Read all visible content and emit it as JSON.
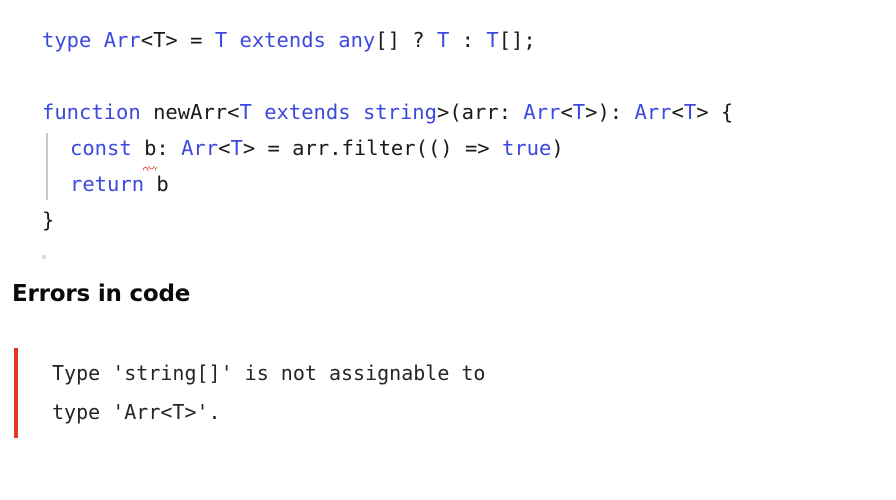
{
  "colors": {
    "keyword_blue": "#3b49df",
    "code_text": "#1a1a1a",
    "error_red": "#e8352a",
    "squiggle_red": "#e0392b",
    "indent_guide": "#c9c9c9",
    "heading": "#0a0a0a",
    "background": "#ffffff"
  },
  "code": {
    "language": "typescript",
    "lines": [
      {
        "id": "line-1",
        "indent": 0,
        "tokens": [
          {
            "text": "type",
            "kind": "keyword"
          },
          {
            "text": " ",
            "kind": "plain"
          },
          {
            "text": "Arr",
            "kind": "type"
          },
          {
            "text": "<T> = ",
            "kind": "plain"
          },
          {
            "text": "T",
            "kind": "type"
          },
          {
            "text": " ",
            "kind": "plain"
          },
          {
            "text": "extends",
            "kind": "keyword"
          },
          {
            "text": " ",
            "kind": "plain"
          },
          {
            "text": "any",
            "kind": "type"
          },
          {
            "text": "[] ? ",
            "kind": "plain"
          },
          {
            "text": "T",
            "kind": "type"
          },
          {
            "text": " : ",
            "kind": "plain"
          },
          {
            "text": "T",
            "kind": "type"
          },
          {
            "text": "[];",
            "kind": "plain"
          }
        ]
      },
      {
        "id": "line-2",
        "indent": 0,
        "blank": true,
        "tokens": []
      },
      {
        "id": "line-3",
        "indent": 0,
        "tokens": [
          {
            "text": "function",
            "kind": "keyword"
          },
          {
            "text": " newArr<",
            "kind": "plain"
          },
          {
            "text": "T",
            "kind": "type"
          },
          {
            "text": " ",
            "kind": "plain"
          },
          {
            "text": "extends",
            "kind": "keyword"
          },
          {
            "text": " ",
            "kind": "plain"
          },
          {
            "text": "string",
            "kind": "type"
          },
          {
            "text": ">(arr: ",
            "kind": "plain"
          },
          {
            "text": "Arr",
            "kind": "type"
          },
          {
            "text": "<",
            "kind": "plain"
          },
          {
            "text": "T",
            "kind": "type"
          },
          {
            "text": ">): ",
            "kind": "plain"
          },
          {
            "text": "Arr",
            "kind": "type"
          },
          {
            "text": "<",
            "kind": "plain"
          },
          {
            "text": "T",
            "kind": "type"
          },
          {
            "text": "> {",
            "kind": "plain"
          }
        ]
      },
      {
        "id": "line-4",
        "indent": 1,
        "tokens": [
          {
            "text": "const",
            "kind": "keyword"
          },
          {
            "text": " ",
            "kind": "plain"
          },
          {
            "text": "b",
            "kind": "plain",
            "error": true
          },
          {
            "text": ": ",
            "kind": "plain"
          },
          {
            "text": "Arr",
            "kind": "type"
          },
          {
            "text": "<",
            "kind": "plain"
          },
          {
            "text": "T",
            "kind": "type"
          },
          {
            "text": "> = arr.filter(() => ",
            "kind": "plain"
          },
          {
            "text": "true",
            "kind": "keyword"
          },
          {
            "text": ")",
            "kind": "plain"
          }
        ]
      },
      {
        "id": "line-5",
        "indent": 1,
        "tokens": [
          {
            "text": "return",
            "kind": "keyword"
          },
          {
            "text": " b",
            "kind": "plain"
          }
        ]
      },
      {
        "id": "line-6",
        "indent": 0,
        "tokens": [
          {
            "text": "}",
            "kind": "plain"
          }
        ]
      }
    ]
  },
  "errors_section": {
    "heading": "Errors in code",
    "message_lines": [
      "Type 'string[]' is not assignable to",
      "type 'Arr<T>'."
    ]
  }
}
